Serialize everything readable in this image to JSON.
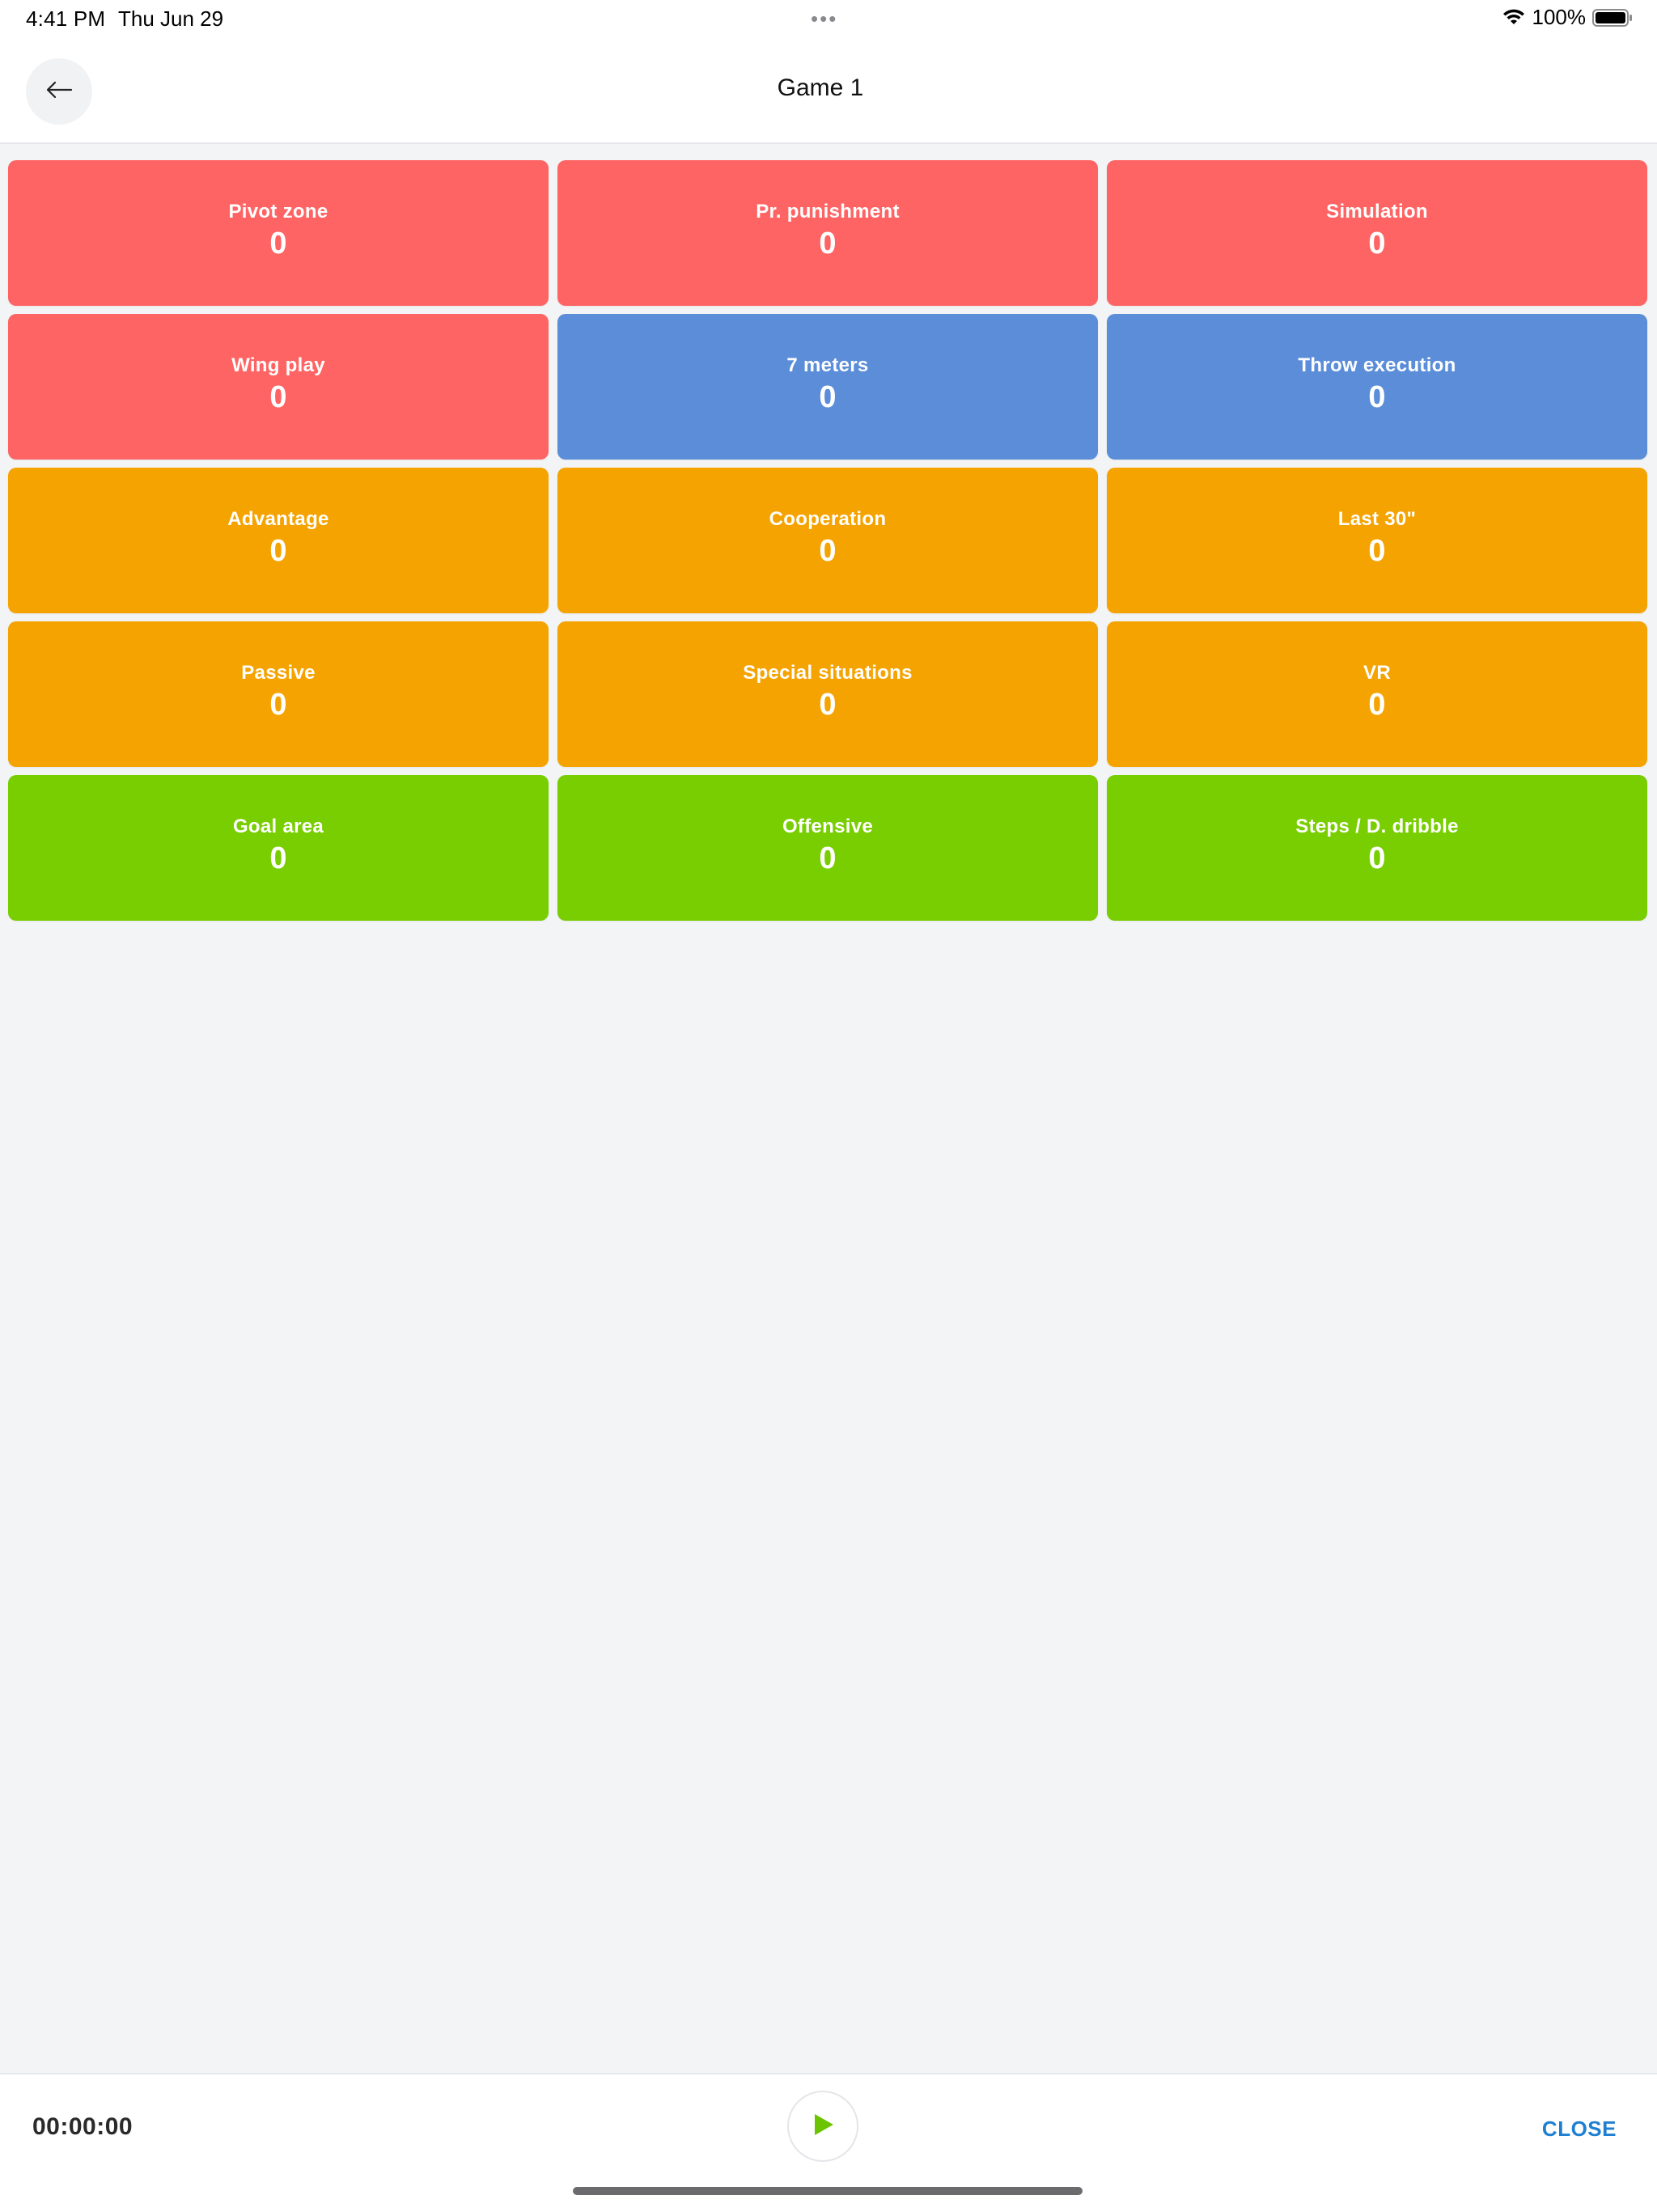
{
  "status_bar": {
    "time": "4:41 PM",
    "date": "Thu Jun 29",
    "dots": "•••",
    "battery": "100%",
    "icons": [
      "wifi-icon",
      "battery-icon"
    ]
  },
  "header": {
    "title": "Game 1",
    "back_icon": "arrow-left-icon"
  },
  "colors": {
    "red": "#ff6464",
    "blue": "#5b8dd9",
    "orange": "#f5a300",
    "green": "#78ce00",
    "accent": "#1f7fd1"
  },
  "tiles": [
    {
      "label": "Pivot zone",
      "count": "0",
      "color": "#ff6464"
    },
    {
      "label": "Pr. punishment",
      "count": "0",
      "color": "#ff6464"
    },
    {
      "label": "Simulation",
      "count": "0",
      "color": "#ff6464"
    },
    {
      "label": "Wing play",
      "count": "0",
      "color": "#ff6464"
    },
    {
      "label": "7 meters",
      "count": "0",
      "color": "#5b8dd9"
    },
    {
      "label": "Throw execution",
      "count": "0",
      "color": "#5b8dd9"
    },
    {
      "label": "Advantage",
      "count": "0",
      "color": "#f5a300"
    },
    {
      "label": "Cooperation",
      "count": "0",
      "color": "#f5a300"
    },
    {
      "label": "Last 30\"",
      "count": "0",
      "color": "#f5a300"
    },
    {
      "label": "Passive",
      "count": "0",
      "color": "#f5a300"
    },
    {
      "label": "Special situations",
      "count": "0",
      "color": "#f5a300"
    },
    {
      "label": "VR",
      "count": "0",
      "color": "#f5a300"
    },
    {
      "label": "Goal area",
      "count": "0",
      "color": "#78ce00"
    },
    {
      "label": "Offensive",
      "count": "0",
      "color": "#78ce00"
    },
    {
      "label": "Steps / D. dribble",
      "count": "0",
      "color": "#78ce00"
    }
  ],
  "footer": {
    "timer": "00:00:00",
    "play_icon": "play-icon",
    "close_label": "CLOSE"
  }
}
